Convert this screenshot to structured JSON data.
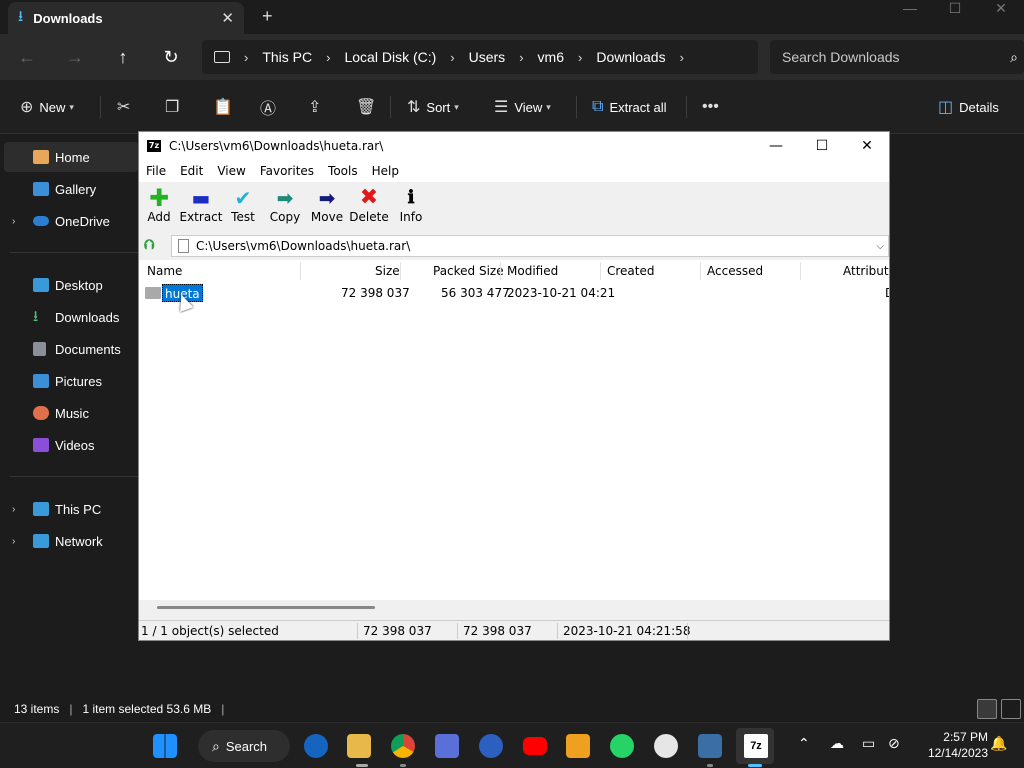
{
  "explorer": {
    "tab_title": "Downloads",
    "breadcrumb": [
      "This PC",
      "Local Disk (C:)",
      "Users",
      "vm6",
      "Downloads"
    ],
    "search_placeholder": "Search Downloads",
    "commands": {
      "new": "New",
      "sort": "Sort",
      "view": "View",
      "extract_all": "Extract all",
      "details": "Details"
    },
    "sidebar": {
      "home": "Home",
      "gallery": "Gallery",
      "onedrive": "OneDrive",
      "desktop": "Desktop",
      "downloads": "Downloads",
      "documents": "Documents",
      "pictures": "Pictures",
      "music": "Music",
      "videos": "Videos",
      "this_pc": "This PC",
      "network": "Network"
    },
    "status": {
      "items": "13 items",
      "selected": "1 item selected  53.6 MB"
    }
  },
  "sevenzip": {
    "title": "C:\\Users\\vm6\\Downloads\\hueta.rar\\",
    "logo": "7z",
    "menu": [
      "File",
      "Edit",
      "View",
      "Favorites",
      "Tools",
      "Help"
    ],
    "toolbar": {
      "add": "Add",
      "extract": "Extract",
      "test": "Test",
      "copy": "Copy",
      "move": "Move",
      "delete": "Delete",
      "info": "Info"
    },
    "path": "C:\\Users\\vm6\\Downloads\\hueta.rar\\",
    "columns": {
      "name": "Name",
      "size": "Size",
      "packed_size": "Packed Size",
      "modified": "Modified",
      "created": "Created",
      "accessed": "Accessed",
      "attributes": "Attribute"
    },
    "rows": [
      {
        "name": "hueta",
        "size": "72 398 037",
        "packed_size": "56 303 477",
        "modified": "2023-10-21 04:21",
        "created": "",
        "accessed": "",
        "attributes": "D"
      }
    ],
    "status": {
      "selection": "1 / 1 object(s) selected",
      "size": "72 398 037",
      "packed": "72 398 037",
      "modified": "2023-10-21 04:21:58"
    }
  },
  "taskbar": {
    "search_label": "Search",
    "time": "2:57 PM",
    "date": "12/14/2023"
  }
}
